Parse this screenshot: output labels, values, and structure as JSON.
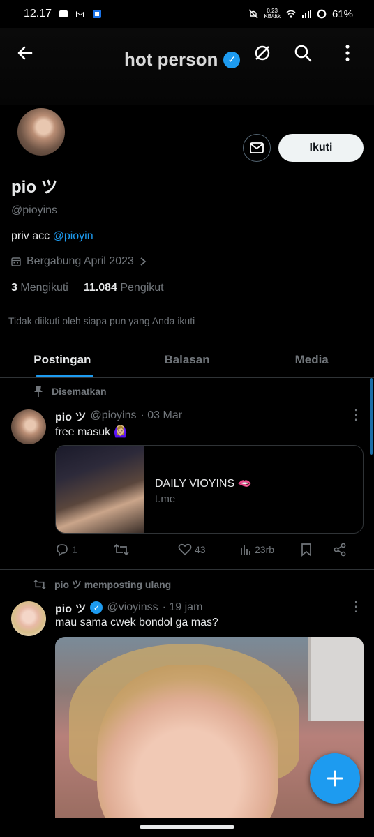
{
  "status_bar": {
    "time": "12.17",
    "net_speed_value": "0,23",
    "net_speed_unit": "KB/dtk",
    "battery": "61%"
  },
  "header": {
    "title": "hot person"
  },
  "profile": {
    "follow_label": "Ikuti",
    "name": "pio ツ",
    "handle": "@pioyins",
    "bio_text": "priv acc ",
    "bio_link": "@pioyin_",
    "joined": "Bergabung April 2023",
    "following_count": "3",
    "following_label": "Mengikuti",
    "followers_count": "11.084",
    "followers_label": "Pengikut",
    "not_followed_note": "Tidak diikuti oleh siapa pun yang Anda ikuti"
  },
  "tabs": [
    {
      "label": "Postingan"
    },
    {
      "label": "Balasan"
    },
    {
      "label": "Media"
    }
  ],
  "posts": [
    {
      "context": "Disematkan",
      "name": "pio ツ",
      "handle": "@pioyins",
      "date": "· 03 Mar",
      "text": "free masuk 🙆🏼‍♀️",
      "card_title": "DAILY VIOYINS 🫦",
      "card_domain": "t.me",
      "replies": "1",
      "likes": "43",
      "views": "23rb"
    },
    {
      "context": "pio ツ memposting ulang",
      "name": "pio ツ",
      "handle": "@vioyinss",
      "date": "· 19 jam",
      "text": "mau sama cwek bondol ga mas?"
    }
  ],
  "colors": {
    "accent": "#1d9bf0",
    "background": "#000000",
    "secondary_text": "#71767b"
  }
}
